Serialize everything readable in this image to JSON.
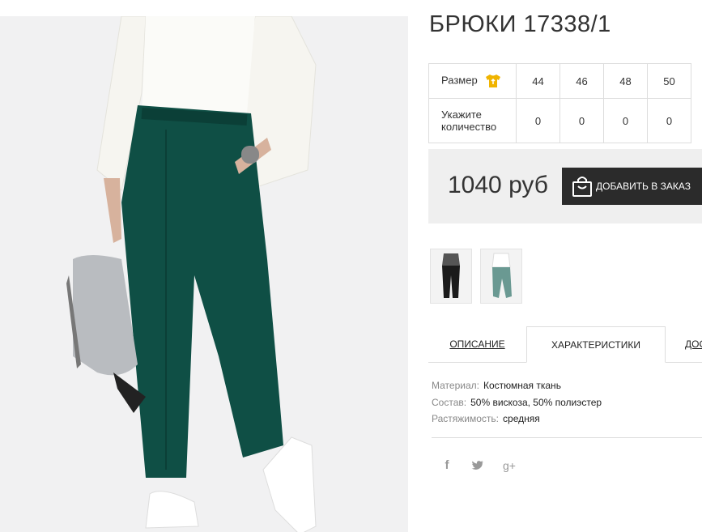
{
  "product": {
    "title": "БРЮКИ 17338/1"
  },
  "sizes": {
    "size_label": "Размер",
    "size_icon": "tshirt-icon",
    "values": [
      "44",
      "46",
      "48",
      "50"
    ],
    "qty_label_line1": "Укажите",
    "qty_label_line2": "количество",
    "quantities": [
      "0",
      "0",
      "0",
      "0"
    ]
  },
  "purchase": {
    "price": "1040 руб",
    "add_label": "ДОБАВИТЬ В ЗАКАЗ",
    "add_icon": "shopping-bag-icon"
  },
  "tabs": [
    {
      "label": "ОПИСАНИЕ"
    },
    {
      "label": "ХАРАКТЕРИСТИКИ"
    },
    {
      "label": "ДОСТАВКА"
    }
  ],
  "characteristics": [
    {
      "key": "Материал:",
      "value": "Костюмная ткань"
    },
    {
      "key": "Состав:",
      "value": "50% вискоза, 50% полиэстер"
    },
    {
      "key": "Растяжимость:",
      "value": "средняя"
    }
  ],
  "social": {
    "facebook": "f",
    "twitter": "twitter-icon",
    "gplus": "g+"
  },
  "colors": {
    "accent_icon": "#f0b400",
    "button": "#2b2b2b",
    "panel": "#efefef",
    "pants": "#0f4f45"
  }
}
